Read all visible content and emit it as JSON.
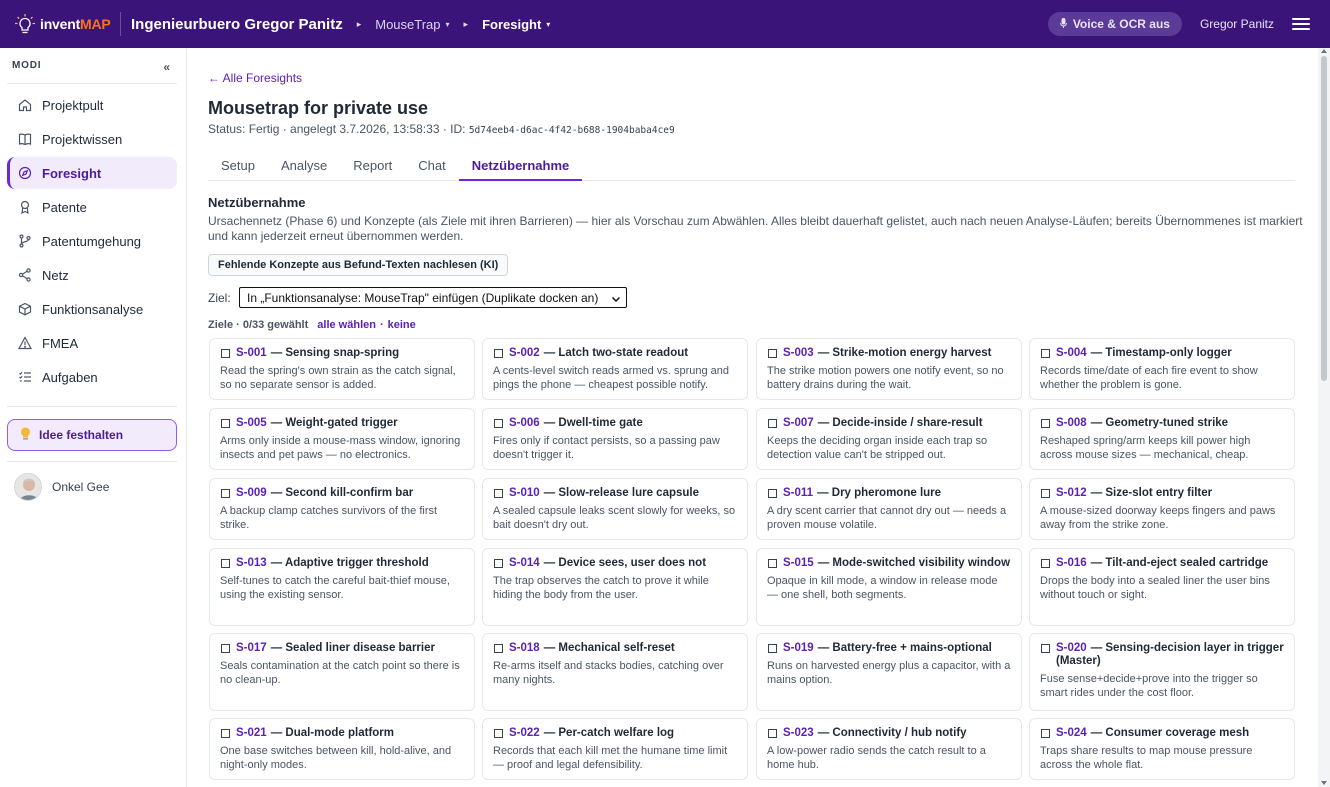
{
  "app": {
    "logo_main": "invent",
    "logo_accent": "MAP"
  },
  "header": {
    "org": "Ingenieurbuero Gregor Panitz",
    "project": "MouseTrap",
    "module": "Foresight",
    "voice_label": "Voice & OCR aus",
    "user": "Gregor Panitz"
  },
  "sidebar": {
    "section_label": "MODI",
    "collapse": "«",
    "items": [
      {
        "label": "Projektpult",
        "icon": "home-icon"
      },
      {
        "label": "Projektwissen",
        "icon": "book-icon"
      },
      {
        "label": "Foresight",
        "icon": "compass-icon",
        "active": true
      },
      {
        "label": "Patente",
        "icon": "award-icon"
      },
      {
        "label": "Patentumgehung",
        "icon": "branch-icon"
      },
      {
        "label": "Netz",
        "icon": "share-icon"
      },
      {
        "label": "Funktionsanalyse",
        "icon": "cube-icon"
      },
      {
        "label": "FMEA",
        "icon": "warning-icon"
      },
      {
        "label": "Aufgaben",
        "icon": "list-icon"
      }
    ],
    "idea_label": "Idee festhalten",
    "user_name": "Onkel Gee"
  },
  "main": {
    "back_link": "← Alle Foresights",
    "title": "Mousetrap for private use",
    "status_text": "Status: Fertig · angelegt 3.7.2026, 13:58:33 · ID: ",
    "status_id": "5d74eeb4-d6ac-4f42-b688-1904baba4ce9",
    "tabs": [
      "Setup",
      "Analyse",
      "Report",
      "Chat",
      "Netzübernahme"
    ],
    "active_tab": 4,
    "section_title": "Netzübernahme",
    "section_desc": "Ursachennetz (Phase 6) und Konzepte (als Ziele mit ihren Barrieren) — hier als Vorschau zum Abwählen. Alles bleibt dauerhaft gelistet, auch nach neuen Analyse-Läufen; bereits Übernommenes ist markiert und kann jederzeit erneut übernommen werden.",
    "ki_button": "Fehlende Konzepte aus Befund-Texten nachlesen (KI)",
    "ziel_label": "Ziel:",
    "ziel_value": "In „Funktionsanalyse: MouseTrap\" einfügen (Duplikate docken an)",
    "count_text": "Ziele · 0/33 gewählt",
    "select_all": "alle wählen",
    "dot": "·",
    "select_none": "keine",
    "cards": [
      {
        "code": "S-001",
        "title": "— Sensing snap-spring",
        "desc": "Read the spring's own strain as the catch signal, so no separate sensor is added."
      },
      {
        "code": "S-002",
        "title": "— Latch two-state readout",
        "desc": "A cents-level switch reads armed vs. sprung and pings the phone — cheapest possible notify."
      },
      {
        "code": "S-003",
        "title": "— Strike-motion energy harvest",
        "desc": "The strike motion powers one notify event, so no battery drains during the wait."
      },
      {
        "code": "S-004",
        "title": "— Timestamp-only logger",
        "desc": "Records time/date of each fire event to show whether the problem is gone."
      },
      {
        "code": "S-005",
        "title": "— Weight-gated trigger",
        "desc": "Arms only inside a mouse-mass window, ignoring insects and pet paws — no electronics."
      },
      {
        "code": "S-006",
        "title": "— Dwell-time gate",
        "desc": "Fires only if contact persists, so a passing paw doesn't trigger it."
      },
      {
        "code": "S-007",
        "title": "— Decide-inside / share-result",
        "desc": "Keeps the deciding organ inside each trap so detection value can't be stripped out."
      },
      {
        "code": "S-008",
        "title": "— Geometry-tuned strike",
        "desc": "Reshaped spring/arm keeps kill power high across mouse sizes — mechanical, cheap."
      },
      {
        "code": "S-009",
        "title": "— Second kill-confirm bar",
        "desc": "A backup clamp catches survivors of the first strike."
      },
      {
        "code": "S-010",
        "title": "— Slow-release lure capsule",
        "desc": "A sealed capsule leaks scent slowly for weeks, so bait doesn't dry out."
      },
      {
        "code": "S-011",
        "title": "— Dry pheromone lure",
        "desc": "A dry scent carrier that cannot dry out — needs a proven mouse volatile."
      },
      {
        "code": "S-012",
        "title": "— Size-slot entry filter",
        "desc": "A mouse-sized doorway keeps fingers and paws away from the strike zone."
      },
      {
        "code": "S-013",
        "title": "— Adaptive trigger threshold",
        "desc": "Self-tunes to catch the careful bait-thief mouse, using the existing sensor."
      },
      {
        "code": "S-014",
        "title": "— Device sees, user does not",
        "desc": "The trap observes the catch to prove it while hiding the body from the user."
      },
      {
        "code": "S-015",
        "title": "— Mode-switched visibility window",
        "desc": "Opaque in kill mode, a window in release mode — one shell, both segments."
      },
      {
        "code": "S-016",
        "title": "— Tilt-and-eject sealed cartridge",
        "desc": "Drops the body into a sealed liner the user bins without touch or sight."
      },
      {
        "code": "S-017",
        "title": "— Sealed liner disease barrier",
        "desc": "Seals contamination at the catch point so there is no clean-up."
      },
      {
        "code": "S-018",
        "title": "— Mechanical self-reset",
        "desc": "Re-arms itself and stacks bodies, catching over many nights."
      },
      {
        "code": "S-019",
        "title": "— Battery-free + mains-optional",
        "desc": "Runs on harvested energy plus a capacitor, with a mains option."
      },
      {
        "code": "S-020",
        "title": "— Sensing-decision layer in trigger (Master)",
        "desc": "Fuse sense+decide+prove into the trigger so smart rides under the cost floor."
      },
      {
        "code": "S-021",
        "title": "— Dual-mode platform",
        "desc": "One base switches between kill, hold-alive, and night-only modes."
      },
      {
        "code": "S-022",
        "title": "— Per-catch welfare log",
        "desc": "Records that each kill met the humane time limit — proof and legal defensibility."
      },
      {
        "code": "S-023",
        "title": "— Connectivity / hub notify",
        "desc": "A low-power radio sends the catch result to a home hub."
      },
      {
        "code": "S-024",
        "title": "— Consumer coverage mesh",
        "desc": "Traps share results to map mouse pressure across the whole flat."
      }
    ]
  },
  "colors": {
    "topbar": "#3b1479",
    "accent": "#5b21b6",
    "logo_accent": "#f97316"
  }
}
